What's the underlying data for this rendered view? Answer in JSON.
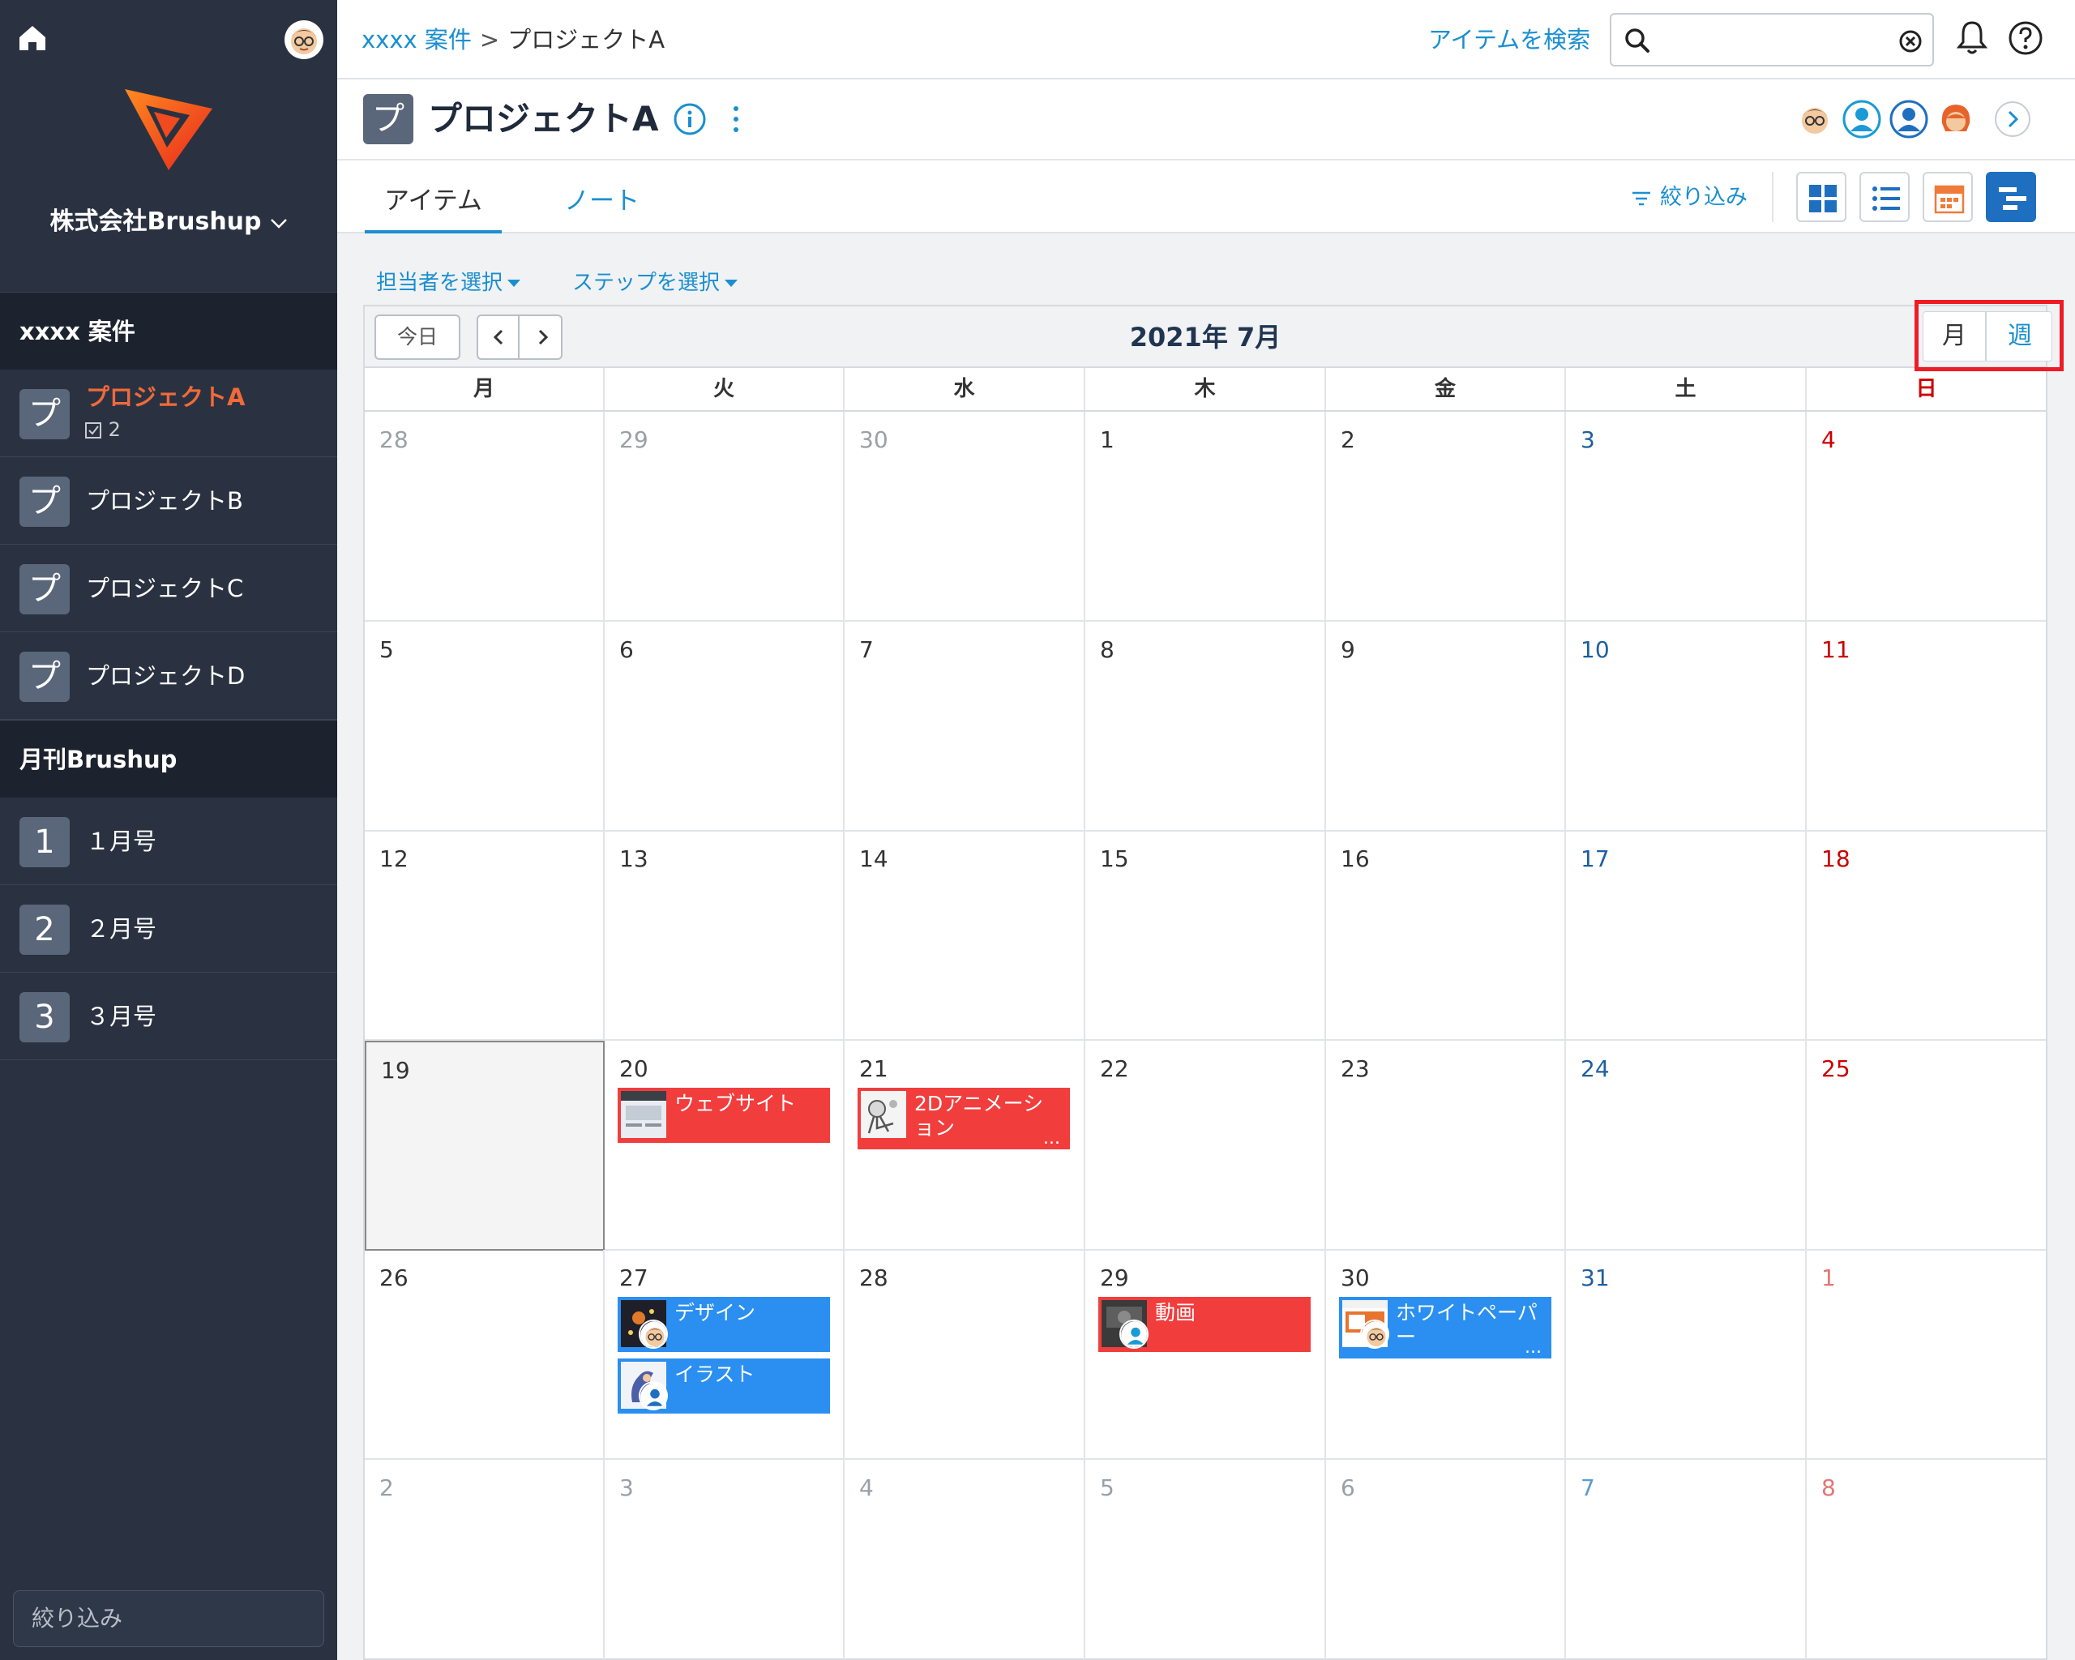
{
  "sidebar": {
    "org_name": "株式会社Brushup",
    "sections": [
      {
        "title": "xxxx 案件"
      },
      {
        "title": "月刊Brushup"
      }
    ],
    "projects": [
      {
        "badge": "プ",
        "label": "プロジェクトA",
        "sub_count": "2"
      },
      {
        "badge": "プ",
        "label": "プロジェクトB"
      },
      {
        "badge": "プ",
        "label": "プロジェクトC"
      },
      {
        "badge": "プ",
        "label": "プロジェクトD"
      }
    ],
    "issues": [
      {
        "badge": "1",
        "label": "１月号"
      },
      {
        "badge": "2",
        "label": "２月号"
      },
      {
        "badge": "3",
        "label": "３月号"
      }
    ],
    "filter_placeholder": "絞り込み"
  },
  "topbar": {
    "breadcrumb_parent": "xxxx 案件",
    "breadcrumb_sep": ">",
    "breadcrumb_current": "プロジェクトA",
    "search_link": "アイテムを検索",
    "search_value": ""
  },
  "project": {
    "badge": "プ",
    "title": "プロジェクトA"
  },
  "tabs": {
    "items": "アイテム",
    "notes": "ノート",
    "filter": "絞り込み"
  },
  "filters": {
    "assignee": "担当者を選択",
    "step": "ステップを選択"
  },
  "calendar": {
    "today_label": "今日",
    "month_title": "2021年 7月",
    "mode_month": "月",
    "mode_week": "週",
    "weekdays": [
      "月",
      "火",
      "水",
      "木",
      "金",
      "土",
      "日"
    ],
    "weeks": [
      [
        {
          "d": "28",
          "other": true
        },
        {
          "d": "29",
          "other": true
        },
        {
          "d": "30",
          "other": true
        },
        {
          "d": "1"
        },
        {
          "d": "2"
        },
        {
          "d": "3"
        },
        {
          "d": "4"
        }
      ],
      [
        {
          "d": "5"
        },
        {
          "d": "6"
        },
        {
          "d": "7"
        },
        {
          "d": "8"
        },
        {
          "d": "9"
        },
        {
          "d": "10"
        },
        {
          "d": "11"
        }
      ],
      [
        {
          "d": "12"
        },
        {
          "d": "13"
        },
        {
          "d": "14"
        },
        {
          "d": "15"
        },
        {
          "d": "16"
        },
        {
          "d": "17"
        },
        {
          "d": "18"
        }
      ],
      [
        {
          "d": "19",
          "today": true
        },
        {
          "d": "20"
        },
        {
          "d": "21"
        },
        {
          "d": "22"
        },
        {
          "d": "23"
        },
        {
          "d": "24"
        },
        {
          "d": "25"
        }
      ],
      [
        {
          "d": "26"
        },
        {
          "d": "27"
        },
        {
          "d": "28"
        },
        {
          "d": "29"
        },
        {
          "d": "30"
        },
        {
          "d": "31"
        },
        {
          "d": "1",
          "other": true
        }
      ],
      [
        {
          "d": "2",
          "other": true
        },
        {
          "d": "3",
          "other": true
        },
        {
          "d": "4",
          "other": true
        },
        {
          "d": "5",
          "other": true
        },
        {
          "d": "6",
          "other": true
        },
        {
          "d": "7",
          "other": true
        },
        {
          "d": "8",
          "other": true
        }
      ]
    ],
    "events": [
      {
        "title": "ウェブサイト",
        "color": "red"
      },
      {
        "title": "2Dアニメーション",
        "color": "red",
        "truncated": "..."
      },
      {
        "title": "デザイン",
        "color": "blue"
      },
      {
        "title": "イラスト",
        "color": "blue"
      },
      {
        "title": "動画",
        "color": "red"
      },
      {
        "title": "ホワイトペーパー",
        "color": "blue",
        "truncated": "..."
      }
    ]
  },
  "colors": {
    "sidebar_bg": "#2a3241",
    "accent_link": "#1a8fd0",
    "active_project": "#f06a3a",
    "event_red": "#f23d3d",
    "event_blue": "#2a8ff0",
    "highlight_frame": "#ee1c25"
  }
}
